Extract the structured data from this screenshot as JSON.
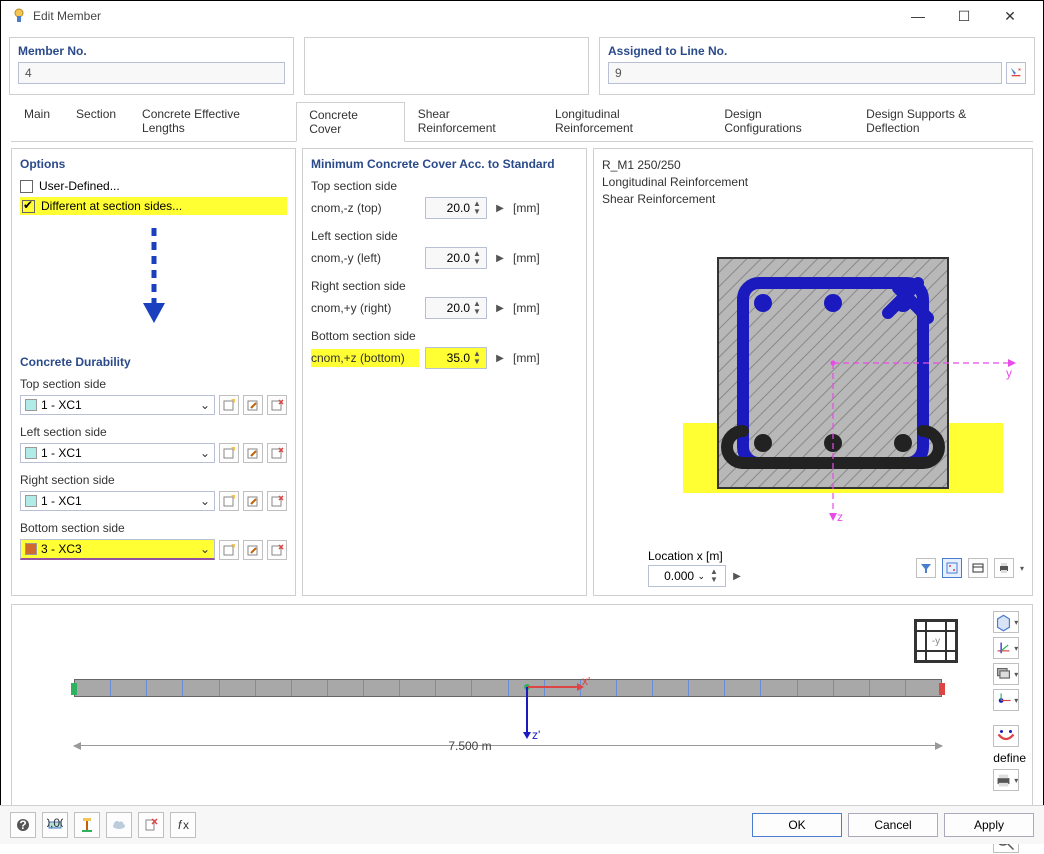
{
  "window": {
    "title": "Edit Member"
  },
  "header": {
    "member_no_label": "Member No.",
    "member_no": "4",
    "assigned_label": "Assigned to Line No.",
    "assigned_value": "9"
  },
  "tabs": [
    "Main",
    "Section",
    "Concrete Effective Lengths",
    "Concrete Cover",
    "Shear Reinforcement",
    "Longitudinal Reinforcement",
    "Design Configurations",
    "Design Supports & Deflection"
  ],
  "active_tab_index": 3,
  "options": {
    "title": "Options",
    "user_defined_label": "User-Defined...",
    "user_defined_checked": false,
    "different_sides_label": "Different at section sides...",
    "different_sides_checked": true
  },
  "durability": {
    "title": "Concrete Durability",
    "items": [
      {
        "label": "Top section side",
        "value": "1 - XC1",
        "swatch": "teal"
      },
      {
        "label": "Left section side",
        "value": "1 - XC1",
        "swatch": "teal"
      },
      {
        "label": "Right section side",
        "value": "1 - XC1",
        "swatch": "teal"
      },
      {
        "label": "Bottom section side",
        "value": "3 - XC3",
        "swatch": "red"
      }
    ]
  },
  "cover": {
    "title": "Minimum Concrete Cover Acc. to Standard",
    "unit": "[mm]",
    "items": [
      {
        "label": "Top section side",
        "sub": "cnom,-z (top)",
        "value": "20.0",
        "hl": false
      },
      {
        "label": "Left section side",
        "sub": "cnom,-y (left)",
        "value": "20.0",
        "hl": false
      },
      {
        "label": "Right section side",
        "sub": "cnom,+y (right)",
        "value": "20.0",
        "hl": false
      },
      {
        "label": "Bottom section side",
        "sub": "cnom,+z (bottom)",
        "value": "35.0",
        "hl": true
      }
    ]
  },
  "preview": {
    "line1": "R_M1 250/250",
    "line2": "Longitudinal Reinforcement",
    "line3": "Shear Reinforcement",
    "location_label": "Location x [m]",
    "location_value": "0.000",
    "axis_y": "y",
    "axis_z": "z"
  },
  "member_preview": {
    "length_label": "7.500 m",
    "axis_x": "x'",
    "axis_z": "z'"
  },
  "footer": {
    "ok": "OK",
    "cancel": "Cancel",
    "apply": "Apply"
  }
}
